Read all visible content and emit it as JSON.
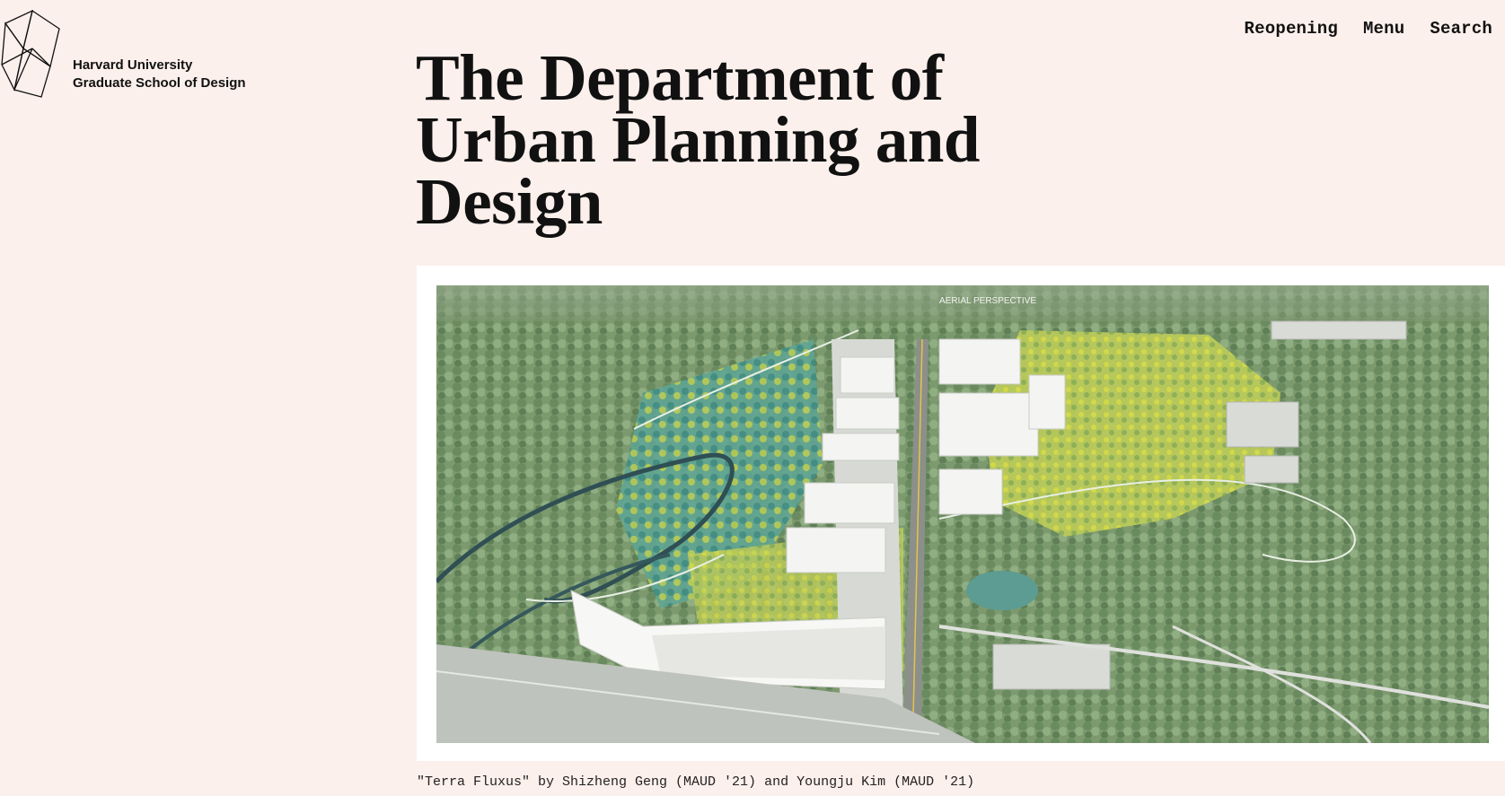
{
  "header": {
    "logo_line1": "Harvard University",
    "logo_line2": "Graduate School of Design",
    "nav": [
      "Reopening",
      "Menu",
      "Search"
    ]
  },
  "main": {
    "title": "The Department of Urban Planning and Design",
    "hero_image_label": "AERIAL PERSPECTIVE",
    "caption": "\"Terra Fluxus\" by Shizheng Geng (MAUD '21) and Youngju Kim (MAUD '21)"
  },
  "colors": {
    "background": "#fcf0ec",
    "text": "#111111",
    "image_frame": "#ffffff"
  }
}
